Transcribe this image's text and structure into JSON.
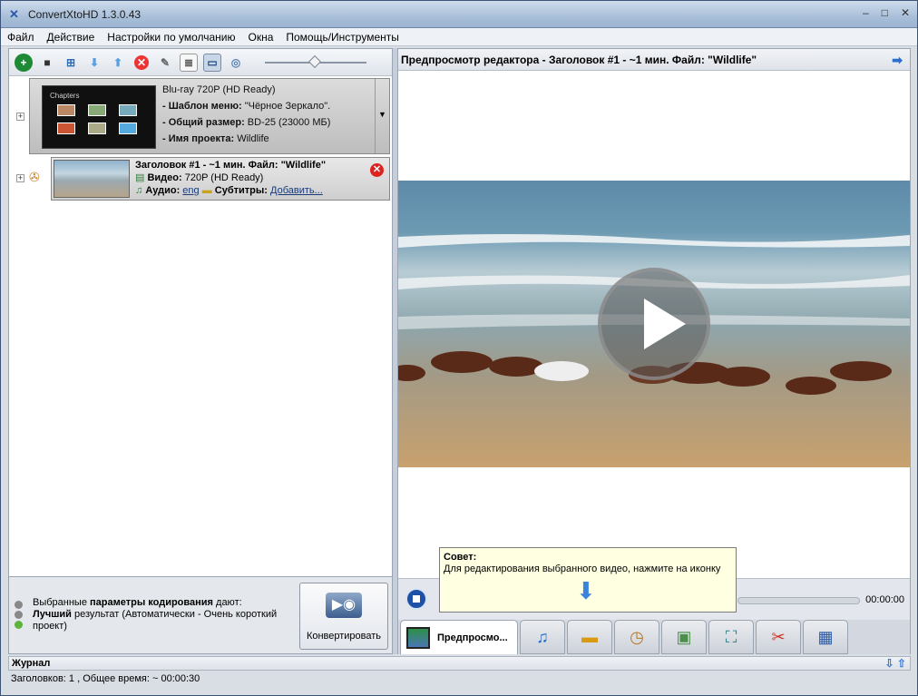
{
  "window": {
    "title": "ConvertXtoHD 1.3.0.43"
  },
  "menu": [
    "Файл",
    "Действие",
    "Настройки по умолчанию",
    "Окна",
    "Помощь/Инструменты"
  ],
  "disc": {
    "format": "Blu-ray 720P (HD Ready)",
    "menu_template_label": "- Шаблон меню:",
    "menu_template_value": "\"Чёрное Зеркало\".",
    "total_size_label": "- Общий размер:",
    "total_size_value": "BD-25 (23000 МБ)",
    "project_name_label": "- Имя проекта:",
    "project_name_value": "Wildlife",
    "thumb_caption": "Chapters"
  },
  "title_item": {
    "heading": "Заголовок #1 - ~1 мин. Файл: \"Wildlife\"",
    "video_label": "Видео:",
    "video_value": "720P (HD Ready)",
    "audio_label": "Аудио:",
    "audio_value": "eng",
    "subs_label": "Субтитры:",
    "subs_value": "Добавить..."
  },
  "encoding": {
    "line1_pre": "Выбранные ",
    "line1_bold": "параметры кодирования",
    "line1_post": " дают:",
    "line2_bold": "Лучший",
    "line2_post": " результат (Автоматически - Очень короткий проект)"
  },
  "convert_button": "Конвертировать",
  "preview": {
    "header": "Предпросмотр редактора - Заголовок #1 - ~1 мин. Файл: \"Wildlife\"",
    "time": "00:00:00",
    "active_tab": "Предпросмо..."
  },
  "tooltip": {
    "title": "Совет:",
    "text": "Для редактирования выбранного видео, нажмите на иконку"
  },
  "journal": {
    "title": "Журнал"
  },
  "status": {
    "text": "Заголовков: 1 , Общее время: ~ 00:00:30"
  }
}
